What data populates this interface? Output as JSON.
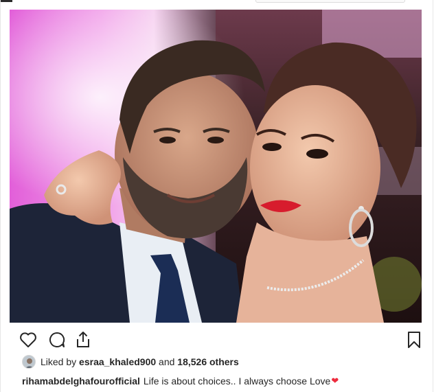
{
  "post": {
    "image_alt": "",
    "likes": {
      "prefix": "Liked by",
      "liker": "esraa_khaled900",
      "connector": "and",
      "count_text": "18,526 others"
    },
    "caption": {
      "username": "rihamabdelghafourofficial",
      "text": "Life is about choices.. I always choose Love",
      "emoji": "❤"
    }
  },
  "icons": {
    "like": "heart-outline-icon",
    "comment": "comment-bubble-icon",
    "share": "share-upload-icon",
    "save": "bookmark-icon"
  },
  "colors": {
    "text": "#262626",
    "heart_emoji": "#ed2b3d",
    "border": "#dbdbdb"
  }
}
